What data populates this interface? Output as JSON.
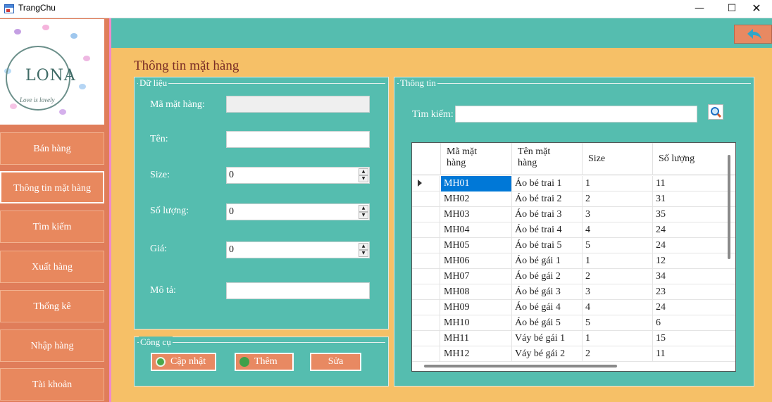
{
  "window": {
    "title": "TrangChu",
    "minimize": "—",
    "maximize": "☐",
    "close": "✕"
  },
  "logo": {
    "brand": "LONA",
    "tagline": "Love is lovely"
  },
  "nav": [
    {
      "label": "Bán hàng"
    },
    {
      "label": "Thông tin mặt hàng"
    },
    {
      "label": "Tìm kiếm"
    },
    {
      "label": "Xuất hàng"
    },
    {
      "label": "Thống kê"
    },
    {
      "label": "Nhập hàng"
    },
    {
      "label": "Tài khoản"
    }
  ],
  "page": {
    "title": "Thông tin mặt hàng"
  },
  "data_panel": {
    "caption": "Dữ liệu",
    "fields": {
      "code_label": "Mã mặt hàng:",
      "code_value": "",
      "name_label": "Tên:",
      "name_value": "",
      "size_label": "Size:",
      "size_value": "0",
      "qty_label": "Số lượng:",
      "qty_value": "0",
      "price_label": "Giá:",
      "price_value": "0",
      "desc_label": "Mô tả:",
      "desc_value": ""
    }
  },
  "tools_panel": {
    "caption": "Công cụ",
    "update_label": "Cập nhật",
    "add_label": "Thêm",
    "edit_label": "Sửa"
  },
  "info_panel": {
    "caption": "Thông tin",
    "search_label": "Tìm kiếm:",
    "search_value": ""
  },
  "table": {
    "columns": [
      {
        "line1": "Mã mặt",
        "line2": "hàng"
      },
      {
        "line1": "Tên mặt",
        "line2": "hàng"
      },
      {
        "line1": "Size",
        "line2": ""
      },
      {
        "line1": "Số lượng",
        "line2": ""
      }
    ],
    "rows": [
      [
        "MH01",
        "Áo bé trai 1",
        "1",
        "11"
      ],
      [
        "MH02",
        "Áo bé trai 2",
        "2",
        "31"
      ],
      [
        "MH03",
        "Áo bé trai 3",
        "3",
        "35"
      ],
      [
        "MH04",
        "Áo bé trai 4",
        "4",
        "24"
      ],
      [
        "MH05",
        "Áo bé trai 5",
        "5",
        "24"
      ],
      [
        "MH06",
        "Áo bé gái 1",
        "1",
        "12"
      ],
      [
        "MH07",
        "Áo bé gái 2",
        "2",
        "34"
      ],
      [
        "MH08",
        "Áo bé gái 3",
        "3",
        "23"
      ],
      [
        "MH09",
        "Áo bé gái 4",
        "4",
        "24"
      ],
      [
        "MH10",
        "Áo bé gái 5",
        "5",
        "6"
      ],
      [
        "MH11",
        "Váy bé gái 1",
        "1",
        "15"
      ],
      [
        "MH12",
        "Váy bé gái 2",
        "2",
        "11"
      ]
    ],
    "selected_row": 0
  },
  "colors": {
    "teal": "#55bdaf",
    "orange": "#e8885e",
    "sand": "#f6c067",
    "title": "#7a2d26",
    "pink_stripe": "#f18acb"
  },
  "icons": {
    "back": "back-arrow-icon",
    "search": "magnifier-icon",
    "refresh": "refresh-icon",
    "add": "plus-icon"
  }
}
